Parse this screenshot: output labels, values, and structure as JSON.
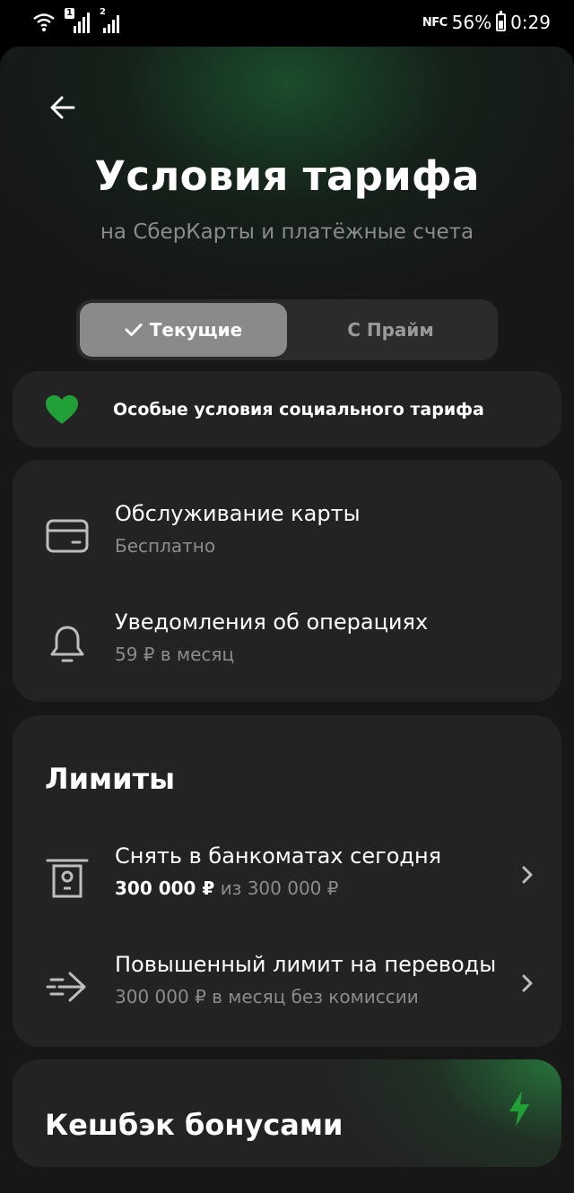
{
  "status_bar": {
    "sim1": "1",
    "sim2": "2",
    "nfc": "NFC",
    "battery": "56%",
    "time": "0:29"
  },
  "header": {
    "title": "Условия тарифа",
    "subtitle": "на СберКарты и платёжные счета"
  },
  "tabs": [
    {
      "label": "Текущие",
      "active": true
    },
    {
      "label": "С Прайм",
      "active": false
    }
  ],
  "social": {
    "label": "Особые условия социального тарифа"
  },
  "service": {
    "items": [
      {
        "title": "Обслуживание карты",
        "subtitle": "Бесплатно",
        "icon": "card-icon"
      },
      {
        "title": "Уведомления об операциях",
        "subtitle": "59 ₽ в месяц",
        "icon": "bell-icon"
      }
    ]
  },
  "limits": {
    "title": "Лимиты",
    "items": [
      {
        "title": "Снять в банкоматах сегодня",
        "value": "300 000 ₽",
        "of": "из 300 000 ₽",
        "icon": "atm-icon"
      },
      {
        "title": "Повышенный лимит на переводы",
        "subtitle": "300 000 ₽ в месяц без комиссии",
        "icon": "transfer-icon"
      }
    ]
  },
  "cashback": {
    "title": "Кешбэк бонусами",
    "icon": "lightning-icon"
  },
  "colors": {
    "accent_green": "#21a038",
    "card_bg": "#232323",
    "muted_text": "#8c8c8c"
  }
}
